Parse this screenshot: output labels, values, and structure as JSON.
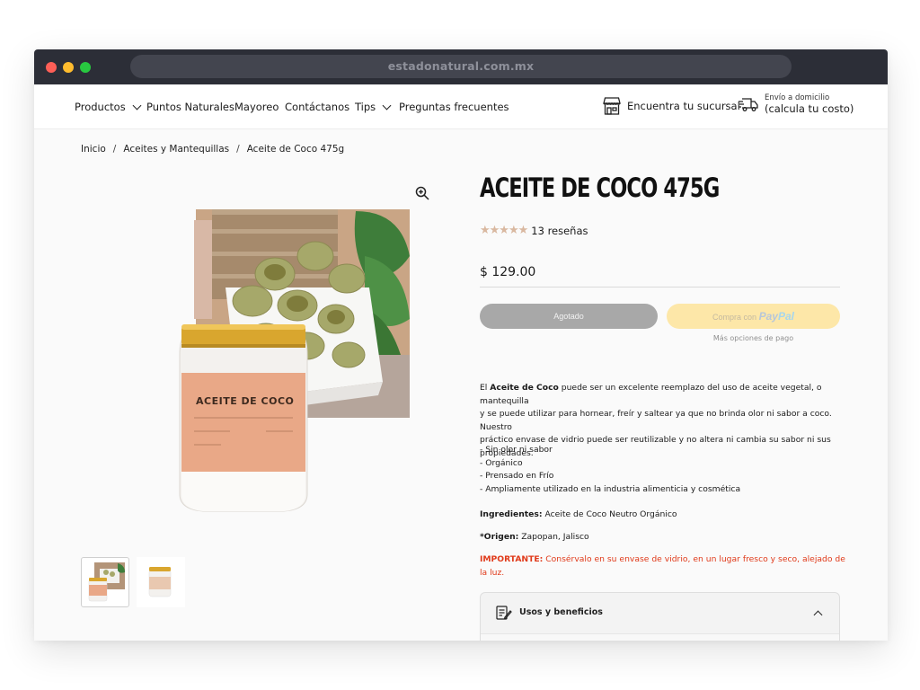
{
  "browser": {
    "url": "estadonatural.com.mx"
  },
  "nav": {
    "items": [
      {
        "label": "Productos",
        "has_dropdown": true
      },
      {
        "label": "Puntos Naturales",
        "has_dropdown": false
      },
      {
        "label": "Mayoreo",
        "has_dropdown": false
      },
      {
        "label": "Contáctanos",
        "has_dropdown": false
      },
      {
        "label": "Tips",
        "has_dropdown": true
      },
      {
        "label": "Preguntas frecuentes",
        "has_dropdown": false
      }
    ],
    "store_label": "Encuentra tu sucursal",
    "delivery_small": "Envío a domicilio",
    "delivery_big": "(calcula tu costo)"
  },
  "breadcrumb": [
    "Inicio",
    "Aceites y Mantequillas",
    "Aceite de Coco 475g"
  ],
  "product": {
    "title": "ACEITE DE COCO 475G",
    "rating": 5,
    "reviews": "13 reseñas",
    "price": "$ 129.00",
    "sold_out_label": "Agotado",
    "paypal_prefix": "Compra con",
    "paypal_brand_1": "Pay",
    "paypal_brand_2": "Pal",
    "more_payment": "Más opciones de pago",
    "jar_label": "ACEITE DE COCO",
    "description": {
      "p1_pre": "El ",
      "p1_bold": "Aceite de Coco",
      "p1_line1": " puede ser un excelente reemplazo del uso de aceite vegetal, o mantequilla",
      "p1_line2": "y se puede utilizar para hornear, freír y saltear ya que no brinda olor ni sabor a coco. Nuestro",
      "p1_line3": "práctico envase de vidrio puede ser reutilizable y no altera ni cambia su sabor ni sus",
      "p1_line4": "propiedades.",
      "bullets": [
        "- Sin olor ni sabor",
        "- Orgánico",
        "- Prensado en Frío",
        "- Ampliamente utilizado en la industria alimenticia y cosmética"
      ],
      "ingredients_label": "Ingredientes:",
      "ingredients_value": " Aceite de Coco Neutro Orgánico",
      "origin_label": "*Origen:",
      "origin_value": " Zapopan, Jalisco",
      "important_label": "IMPORTANTE:",
      "important_value": " Consérvalo en su envase de vidrio, en un lugar fresco y seco, alejado de la luz."
    },
    "accordion_label": "Usos y beneficios"
  },
  "colors": {
    "star": "#d9b8a0",
    "important": "#e03a1a",
    "paypal_bg": "#fde7a8",
    "sold_out_bg": "#a8a8a8"
  }
}
